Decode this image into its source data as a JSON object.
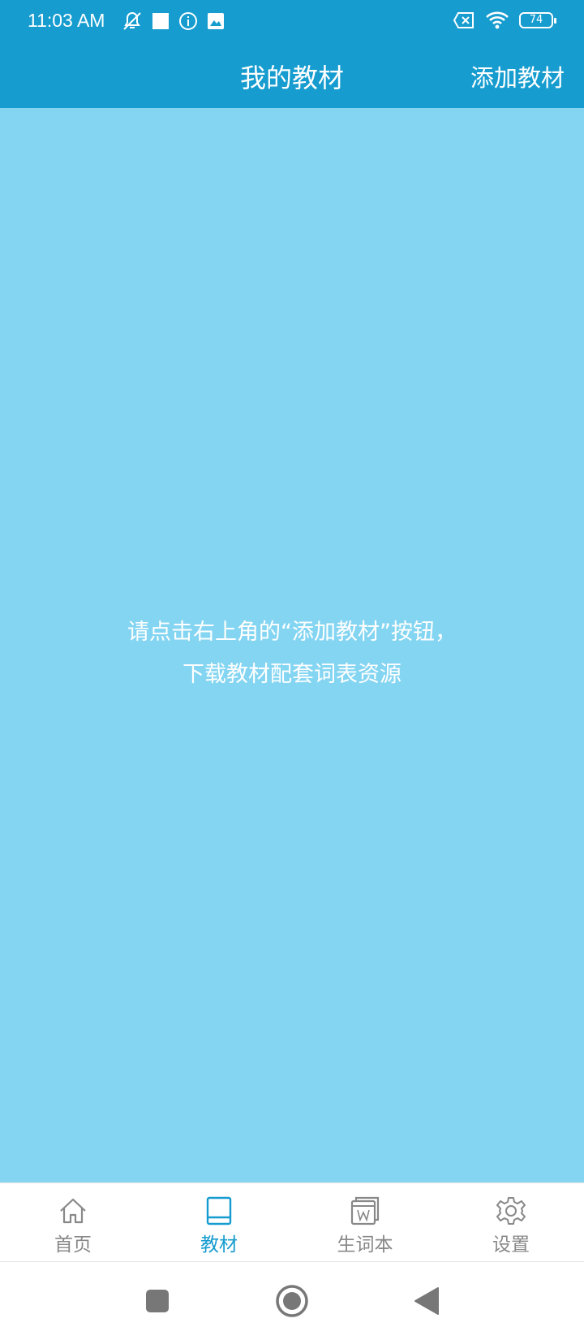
{
  "status_bar": {
    "time": "11:03 AM",
    "battery": "74",
    "icons": [
      "mute-icon",
      "square-icon",
      "info-icon",
      "image-icon",
      "no-sim-icon",
      "wifi-icon",
      "battery-icon"
    ]
  },
  "app_bar": {
    "title": "我的教材",
    "action_label": "添加教材"
  },
  "content": {
    "empty_line1": "请点击右上角的“添加教材”按钮，",
    "empty_line2": "下载教材配套词表资源"
  },
  "tabs": [
    {
      "label": "首页",
      "icon": "home-icon",
      "active": false
    },
    {
      "label": "教材",
      "icon": "book-icon",
      "active": true
    },
    {
      "label": "生词本",
      "icon": "wordbook-icon",
      "active": false
    },
    {
      "label": "设置",
      "icon": "gear-icon",
      "active": false
    }
  ],
  "colors": {
    "primary": "#169ccf",
    "content_bg": "#84d5f2",
    "tab_inactive": "#888888"
  }
}
